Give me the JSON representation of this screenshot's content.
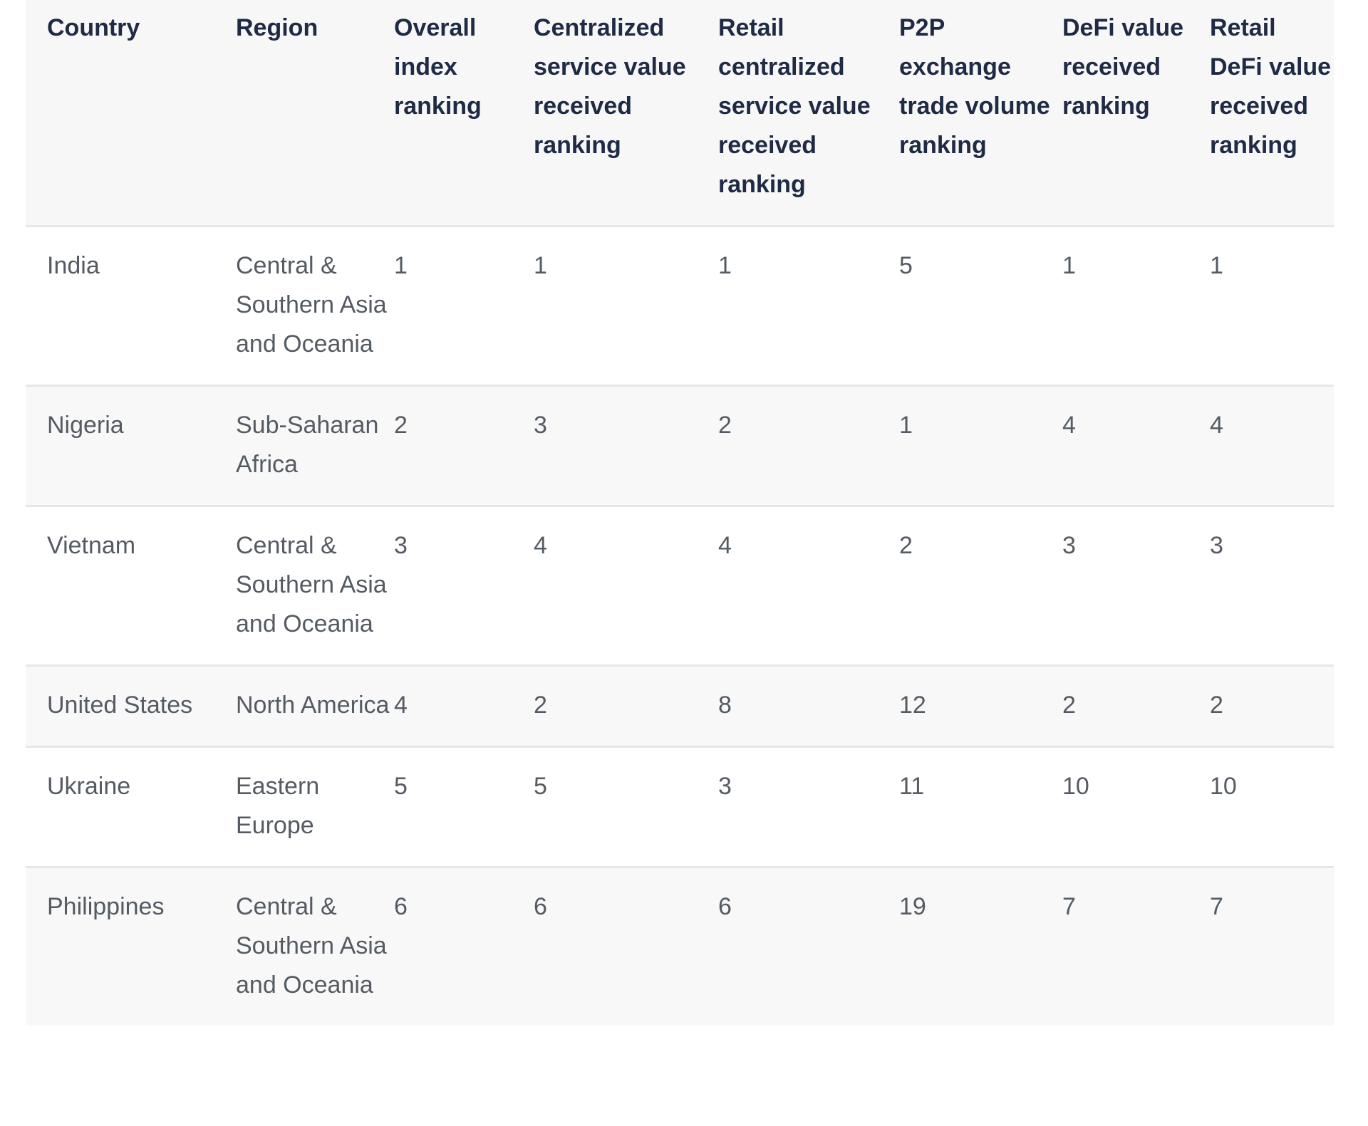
{
  "table": {
    "headers": [
      "Country",
      "Region",
      "Overall index ranking",
      "Centralized service value received ranking",
      "Retail centralized service value received ranking",
      "P2P exchange trade volume ranking",
      "DeFi value received ranking",
      "Retail DeFi value received ranking"
    ],
    "header_lines": [
      [
        "Country"
      ],
      [
        "Region"
      ],
      [
        "Overall",
        "index",
        "ranking"
      ],
      [
        "Centralized",
        "service",
        "value",
        "received",
        "ranking"
      ],
      [
        "Retail",
        "centralized",
        "service",
        "value",
        "received",
        "ranking"
      ],
      [
        "P2P",
        "exchange",
        "trade",
        "volume",
        "ranking"
      ],
      [
        "DeFi",
        "value",
        "received",
        "ranking"
      ],
      [
        "Retail",
        "DeFi",
        "value",
        "received",
        "ranking"
      ]
    ],
    "rows": [
      {
        "country": "India",
        "region": "Central & Southern Asia and Oceania",
        "overall": "1",
        "centralized": "1",
        "retail_centralized": "1",
        "p2p": "5",
        "defi": "1",
        "retail_defi": "1"
      },
      {
        "country": "Nigeria",
        "region": "Sub-Saharan Africa",
        "overall": "2",
        "centralized": "3",
        "retail_centralized": "2",
        "p2p": "1",
        "defi": "4",
        "retail_defi": "4"
      },
      {
        "country": "Vietnam",
        "region": "Central & Southern Asia and Oceania",
        "overall": "3",
        "centralized": "4",
        "retail_centralized": "4",
        "p2p": "2",
        "defi": "3",
        "retail_defi": "3"
      },
      {
        "country": "United States",
        "region": "North America",
        "overall": "4",
        "centralized": "2",
        "retail_centralized": "8",
        "p2p": "12",
        "defi": "2",
        "retail_defi": "2"
      },
      {
        "country": "Ukraine",
        "region": "Eastern Europe",
        "overall": "5",
        "centralized": "5",
        "retail_centralized": "3",
        "p2p": "11",
        "defi": "10",
        "retail_defi": "10"
      },
      {
        "country": "Philippines",
        "region": "Central & Southern Asia and Oceania",
        "overall": "6",
        "centralized": "6",
        "retail_centralized": "6",
        "p2p": "19",
        "defi": "7",
        "retail_defi": "7"
      }
    ]
  },
  "colors": {
    "header_text": "#1f2a44",
    "body_text": "#555b63",
    "header_bg": "#f7f7f7",
    "stripe_bg": "#f8f8f8",
    "border": "#e6e6e6"
  }
}
